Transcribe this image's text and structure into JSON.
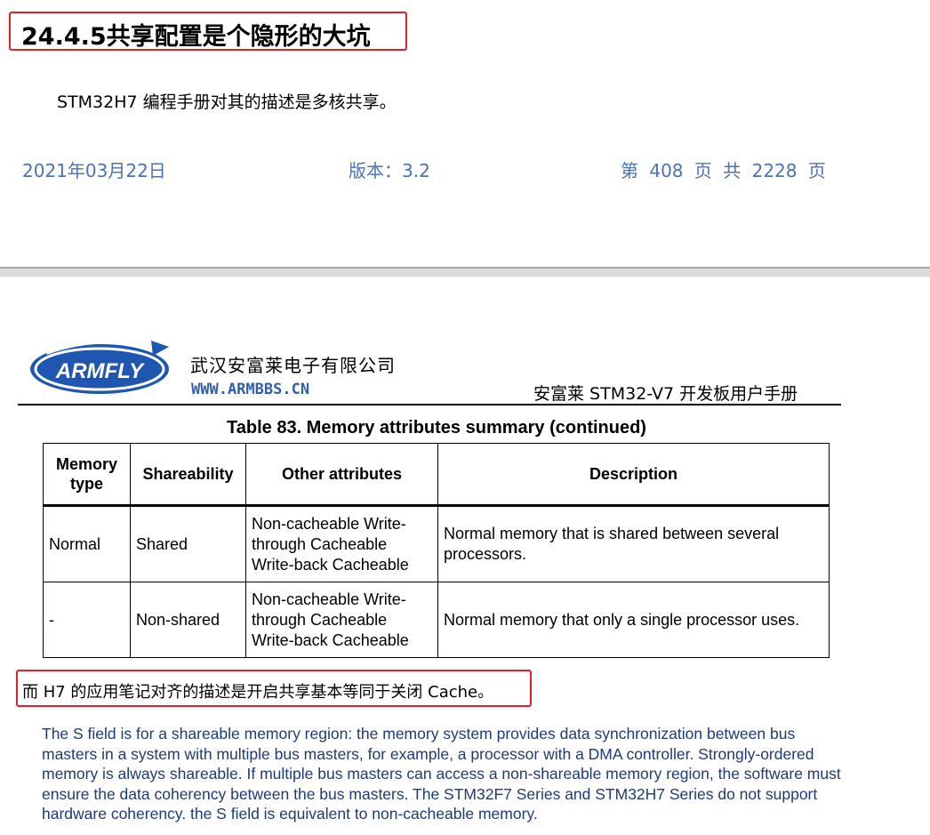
{
  "heading": "24.4.5共享配置是个隐形的大坑",
  "intro": "STM32H7 编程手册对其的描述是多核共享。",
  "footer": {
    "date": "2021年03月22日",
    "version": "版本：3.2",
    "pages": "第 408 页 共 2228 页"
  },
  "manual_header": {
    "logo_text": "ARMFLY",
    "company": "武汉安富莱电子有限公司",
    "url": "WWW.ARMBBS.CN",
    "manual_title": "安富莱 STM32-V7 开发板用户手册"
  },
  "table": {
    "caption": "Table 83. Memory attributes summary (continued)",
    "headers": [
      "Memory type",
      "Shareability",
      "Other attributes",
      "Description"
    ],
    "rows": [
      [
        "Normal",
        "Shared",
        "Non-cacheable Write-through Cacheable Write-back Cacheable",
        "Normal memory that is shared between several processors."
      ],
      [
        "-",
        "Non-shared",
        "Non-cacheable Write-through Cacheable Write-back Cacheable",
        "Normal memory that only a single processor uses."
      ]
    ]
  },
  "note": "而 H7 的应用笔记对齐的描述是开启共享基本等同于关闭 Cache。",
  "s_field_paragraph": "The S field is for a shareable memory region: the memory system provides data synchronization between bus masters in a system with multiple bus masters, for example, a processor with a DMA controller. Strongly-ordered memory is always shareable. If multiple bus masters can access a non-shareable memory region, the software must ensure the data coherency between the bus masters. The STM32F7 Series and STM32H7 Series do not support hardware coherency. the S field is equivalent to non-cacheable memory.",
  "colors": {
    "highlight_border": "#e0202a",
    "footer_blue": "#4a72b8",
    "logo_blue": "#2f5fb3",
    "paragraph_blue": "#1f3a78"
  }
}
